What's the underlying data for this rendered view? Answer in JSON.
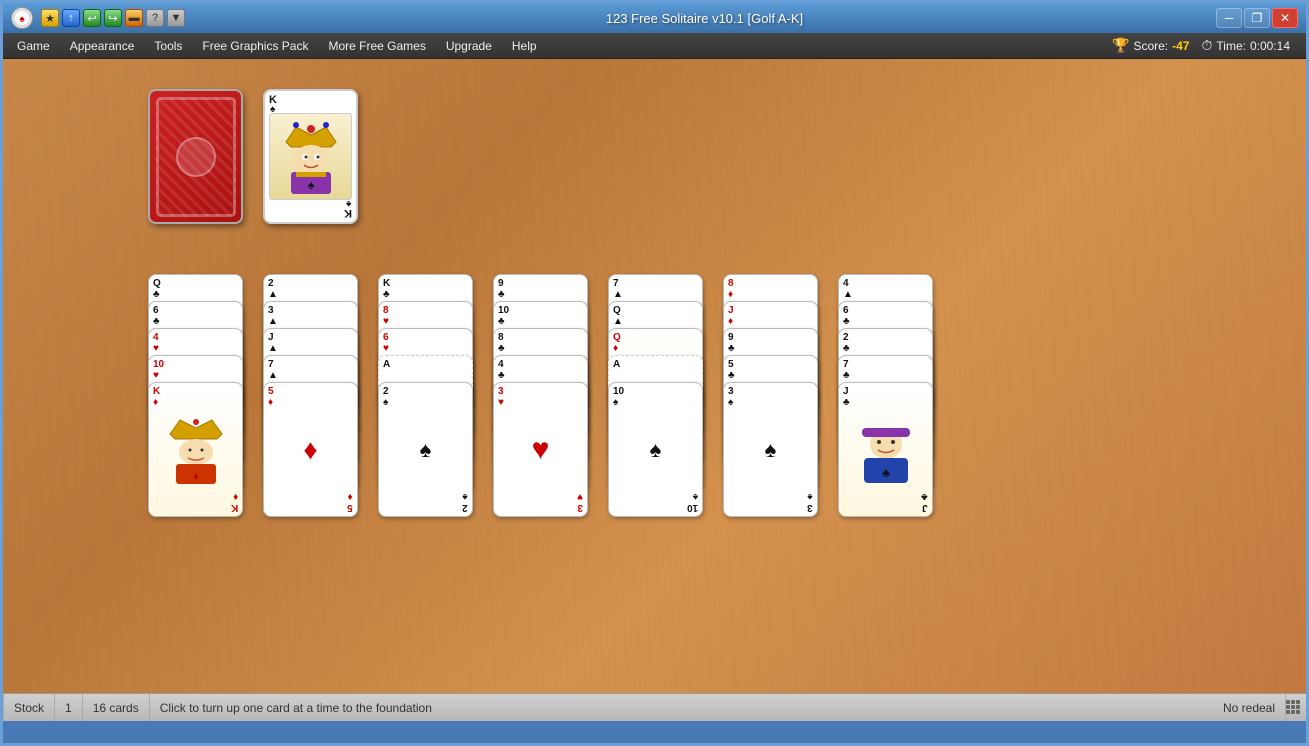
{
  "window": {
    "title": "123 Free Solitaire v10.1  [Golf A-K]"
  },
  "titlebar": {
    "logo": "♠",
    "icons": [
      "●",
      "↑",
      "↩",
      "↪",
      "▬",
      "?",
      "▼"
    ],
    "controls": {
      "minimize": "─",
      "restore": "❐",
      "close": "✕"
    }
  },
  "menubar": {
    "items": [
      "Game",
      "Appearance",
      "Tools",
      "Free Graphics Pack",
      "More Free Games",
      "Upgrade",
      "Help"
    ],
    "score_label": "Score:",
    "score_value": "-47",
    "time_label": "Time:",
    "time_value": "0:00:14"
  },
  "statusbar": {
    "stock_label": "Stock",
    "stock_count": "1",
    "cards_count": "16 cards",
    "message": "Click to turn up one card at a time to the foundation",
    "redeal": "No redeal"
  },
  "game": {
    "top_stock": "card-back",
    "top_foundation": "K♠",
    "columns": [
      {
        "id": "col1",
        "cards": [
          "Q♣",
          "6♣",
          "4♥",
          "10♥",
          "K♦"
        ]
      },
      {
        "id": "col2",
        "cards": [
          "2▲",
          "3▲",
          "J▲",
          "7▲",
          "5♦"
        ]
      },
      {
        "id": "col3",
        "cards": [
          "K♣",
          "8♥",
          "6♥",
          "A",
          "2♠"
        ]
      },
      {
        "id": "col4",
        "cards": [
          "9♣",
          "10♣",
          "8♣",
          "4♣",
          "3♥"
        ]
      },
      {
        "id": "col5",
        "cards": [
          "7▲",
          "Q▲",
          "Q♦",
          "A",
          "10♠"
        ]
      },
      {
        "id": "col6",
        "cards": [
          "8♦",
          "J♦",
          "9♣",
          "5♣",
          "3♠"
        ]
      },
      {
        "id": "col7",
        "cards": [
          "4▲",
          "6♣",
          "2♣",
          "7♣",
          "J♣"
        ]
      }
    ]
  }
}
